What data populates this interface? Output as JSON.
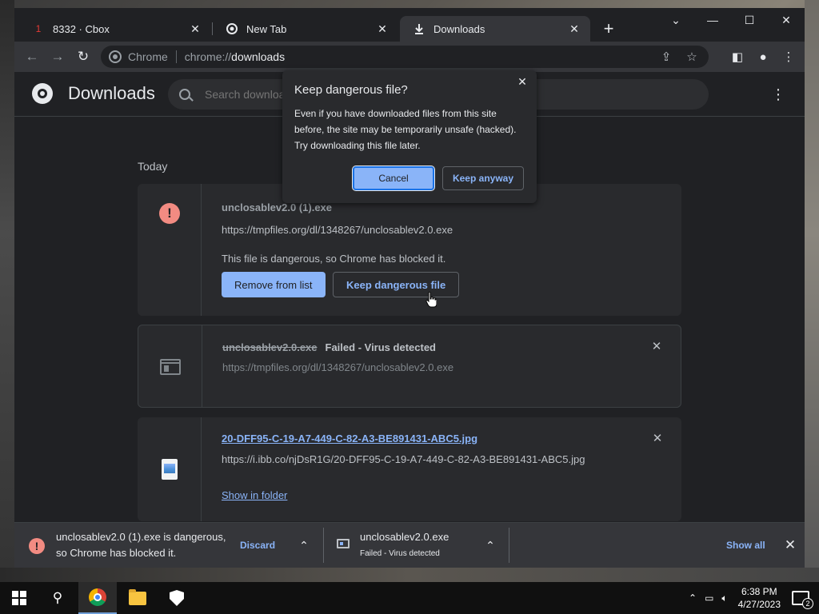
{
  "tabs": [
    {
      "title": "8332 · Cbox",
      "favicon": "1"
    },
    {
      "title": "New Tab",
      "favicon": "chrome-icon"
    },
    {
      "title": "Downloads",
      "favicon": "download-icon"
    }
  ],
  "omnibox": {
    "chip": "Chrome",
    "scheme": "chrome://",
    "host": "downloads"
  },
  "page": {
    "title": "Downloads",
    "search_placeholder": "Search downloads",
    "section": "Today"
  },
  "downloads": [
    {
      "name": "unclosablev2.0 (1).exe",
      "url": "https://tmpfiles.org/dl/1348267/unclosablev2.0.exe",
      "description": "This file is dangerous, so Chrome has blocked it.",
      "primary_button": "Remove from list",
      "secondary_button": "Keep dangerous file"
    },
    {
      "name": "unclosablev2.0.exe",
      "status": "Failed - Virus detected",
      "url": "https://tmpfiles.org/dl/1348267/unclosablev2.0.exe"
    },
    {
      "name": "20-DFF95-C-19-A7-449-C-82-A3-BE891431-ABC5.jpg",
      "url": "https://i.ibb.co/njDsR1G/20-DFF95-C-19-A7-449-C-82-A3-BE891431-ABC5.jpg",
      "link": "Show in folder"
    }
  ],
  "popup": {
    "title": "Keep dangerous file?",
    "body": "Even if you have downloaded files from this site before, the site may be temporarily unsafe (hacked). Try downloading this file later.",
    "cancel": "Cancel",
    "keep": "Keep anyway"
  },
  "shelf": {
    "item1_line1": "unclosablev2.0 (1).exe is dangerous,",
    "item1_line2": "so Chrome has blocked it.",
    "discard": "Discard",
    "item2_name": "unclosablev2.0.exe",
    "item2_status": "Failed - Virus detected",
    "show_all": "Show all"
  },
  "taskbar": {
    "time": "6:38 PM",
    "date": "4/27/2023",
    "notifications": "2"
  },
  "colors": {
    "accent": "#8ab4f8",
    "danger": "#f28b82",
    "bg": "#202124",
    "card": "#292a2d"
  }
}
